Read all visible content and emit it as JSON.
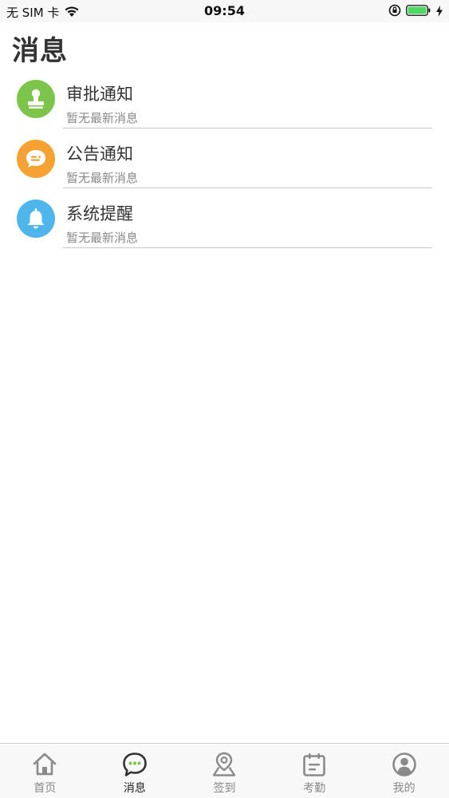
{
  "status_bar": {
    "carrier": "无 SIM 卡",
    "time": "09:54"
  },
  "page": {
    "title": "消息"
  },
  "messages": [
    {
      "title": "审批通知",
      "subtitle": "暂无最新消息",
      "icon": "stamp-icon",
      "color": "#7dc44a"
    },
    {
      "title": "公告通知",
      "subtitle": "暂无最新消息",
      "icon": "chat-bubble-icon",
      "color": "#f5a233"
    },
    {
      "title": "系统提醒",
      "subtitle": "暂无最新消息",
      "icon": "bell-icon",
      "color": "#4fb6ec"
    }
  ],
  "tabs": [
    {
      "label": "首页",
      "icon": "home-icon",
      "active": false
    },
    {
      "label": "消息",
      "icon": "message-icon",
      "active": true
    },
    {
      "label": "签到",
      "icon": "location-pin-icon",
      "active": false
    },
    {
      "label": "考勤",
      "icon": "calendar-icon",
      "active": false
    },
    {
      "label": "我的",
      "icon": "user-icon",
      "active": false
    }
  ],
  "colors": {
    "tab_active": "#222222",
    "tab_inactive": "#888888"
  }
}
